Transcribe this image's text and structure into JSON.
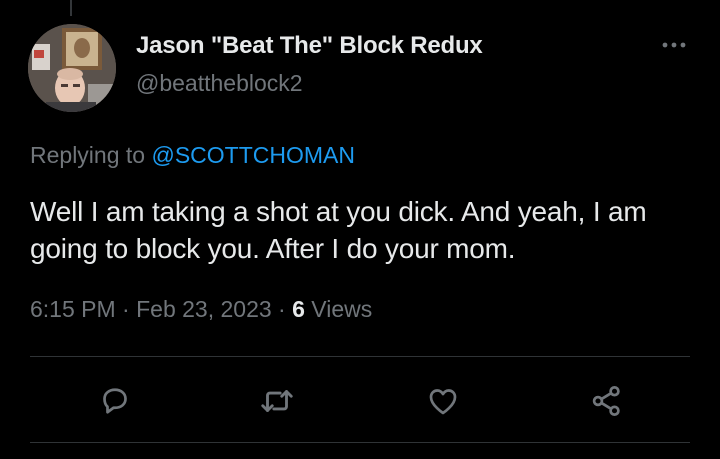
{
  "tweet": {
    "author": {
      "display_name": "Jason \"Beat The\" Block Redux",
      "handle": "@beattheblock2"
    },
    "replying_prefix": "Replying to ",
    "replying_to": "@SCOTTCHOMAN",
    "text": "Well I am taking a shot at you dick. And yeah, I am going to block you. After I do your mom.",
    "time": "6:15 PM",
    "date": "Feb 23, 2023",
    "separator": " · ",
    "views_count": "6",
    "views_label": " Views"
  },
  "icons": {
    "more": "more-horizontal-icon",
    "reply": "reply-icon",
    "retweet": "retweet-icon",
    "like": "heart-icon",
    "share": "share-icon"
  },
  "colors": {
    "background": "#000000",
    "text": "#e7e9ea",
    "secondary": "#71767b",
    "link": "#1d9bf0",
    "divider": "#2f3336"
  }
}
